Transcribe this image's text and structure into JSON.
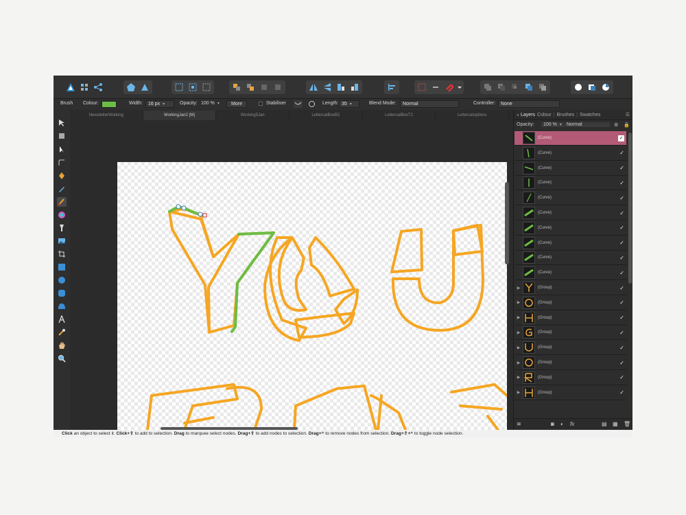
{
  "colors": {
    "stroke_orange": "#f5a623",
    "stroke_green": "#6cbd45",
    "selected_layer": "#b35a77"
  },
  "context": {
    "tool": "Brush",
    "colour_label": "Colour:",
    "width_label": "Width:",
    "width_value": "16 px",
    "opacity_label": "Opacity:",
    "opacity_value": "100 %",
    "more": "More",
    "stabiliser": "Stabiliser",
    "length_label": "Length:",
    "length_value": "35",
    "blend_label": "Blend Mode:",
    "blend_value": "Normal",
    "controller_label": "Controller:",
    "controller_value": "None"
  },
  "tabs": [
    "NewsletterWorking",
    "WorkingJan2 [M]",
    "Working5Jan",
    "LettercatBoxB2",
    "LettercatBoxT2",
    "Lettercatoptions"
  ],
  "panel": {
    "tabs": [
      "Layers",
      "Colour",
      "Brushes",
      "Swatches"
    ],
    "opacity_label": "Opacity:",
    "opacity_value": "100 %",
    "blend_value": "Normal",
    "layers": [
      {
        "name": "(Curve)"
      },
      {
        "name": "(Curve)"
      },
      {
        "name": "(Curve)"
      },
      {
        "name": "(Curve)"
      },
      {
        "name": "(Curve)"
      },
      {
        "name": "(Curve)"
      },
      {
        "name": "(Curve)"
      },
      {
        "name": "(Curve)"
      },
      {
        "name": "(Curve)"
      },
      {
        "name": "(Curve)"
      },
      {
        "name": "(Group)"
      },
      {
        "name": "(Group)"
      },
      {
        "name": "(Group)"
      },
      {
        "name": "(Group)"
      },
      {
        "name": "(Group)"
      },
      {
        "name": "(Group)"
      },
      {
        "name": "(Group)"
      },
      {
        "name": "(Group)"
      }
    ],
    "fx": "fx"
  },
  "status": {
    "s1": "Click",
    "t1": " an object to select it. ",
    "s2": "Click+⇧",
    "t2": " to add to selection. ",
    "s3": "Drag",
    "t3": " to marquee select nodes. ",
    "s4": "Drag+⇧",
    "t4": " to add nodes to selection. ",
    "s5": "Drag+^",
    "t5": " to remove nodes from selection. ",
    "s6": "Drag+⇧+^",
    "t6": " to toggle node selection."
  }
}
